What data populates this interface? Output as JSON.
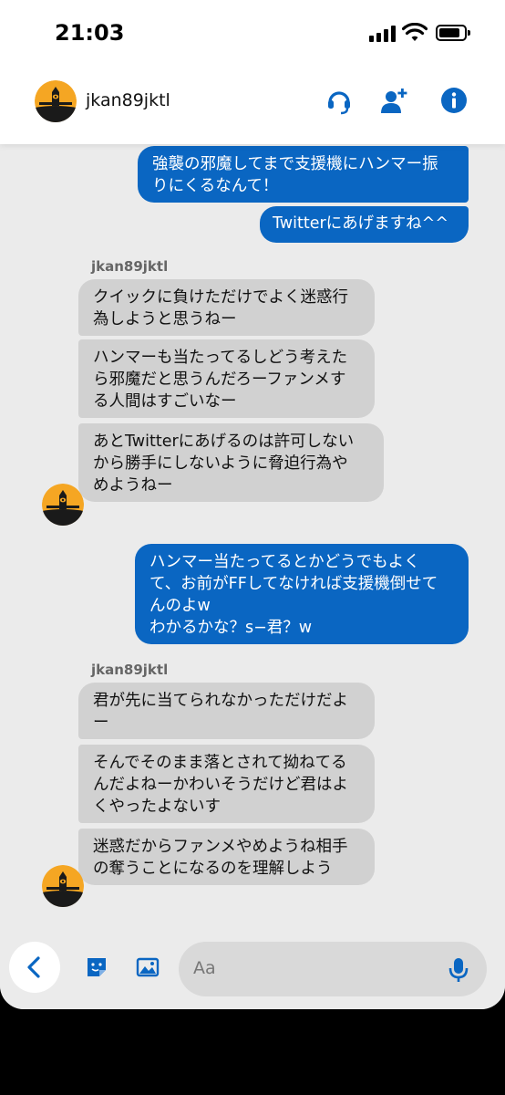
{
  "status_bar": {
    "time": "21:03"
  },
  "header": {
    "contact_name": "jkan89jktl"
  },
  "messages": {
    "out1": "強襲の邪魔してまで支援機にハンマー振\nりにくるなんて！",
    "out2": "Twitterにあげますね^^",
    "sender1": "jkan89jktl",
    "in1": "クイックに負けただけでよく迷惑行\n為しようと思うねー",
    "in2": "ハンマーも当たってるしどう考えた\nら邪魔だと思うんだろーファンメす\nる人間はすごいなー",
    "in3": "あとTwitterにあげるのは許可しない\nから勝手にしないように脅迫行為や\nめようねー",
    "out3": "ハンマー当たってるとかどうでもよく\nて、お前がFFしてなければ支援機倒せて\nんのよw\nわかるかな？s−君？w",
    "sender2": "jkan89jktl",
    "in4": "君が先に当てられなかっただけだよ\nー",
    "in5": "そんでそのまま落とされて拗ねてる\nんだよねーかわいそうだけど君はよ\nくやったよないす",
    "in6": "迷惑だからファンメやめようね相手\nの奪うことになるのを理解しよう"
  },
  "composer": {
    "placeholder": "Aa"
  },
  "colors": {
    "accent": "#0a66c2",
    "outgoing_bubble": "#0a66c2",
    "incoming_bubble": "#d1d1d1",
    "chat_background": "#ebebeb",
    "avatar_orange": "#f5a623"
  },
  "icons": [
    "signal-icon",
    "wifi-icon",
    "battery-icon",
    "headset-icon",
    "add-user-icon",
    "info-icon",
    "back-chevron-icon",
    "sticker-icon",
    "image-icon",
    "mic-icon"
  ]
}
